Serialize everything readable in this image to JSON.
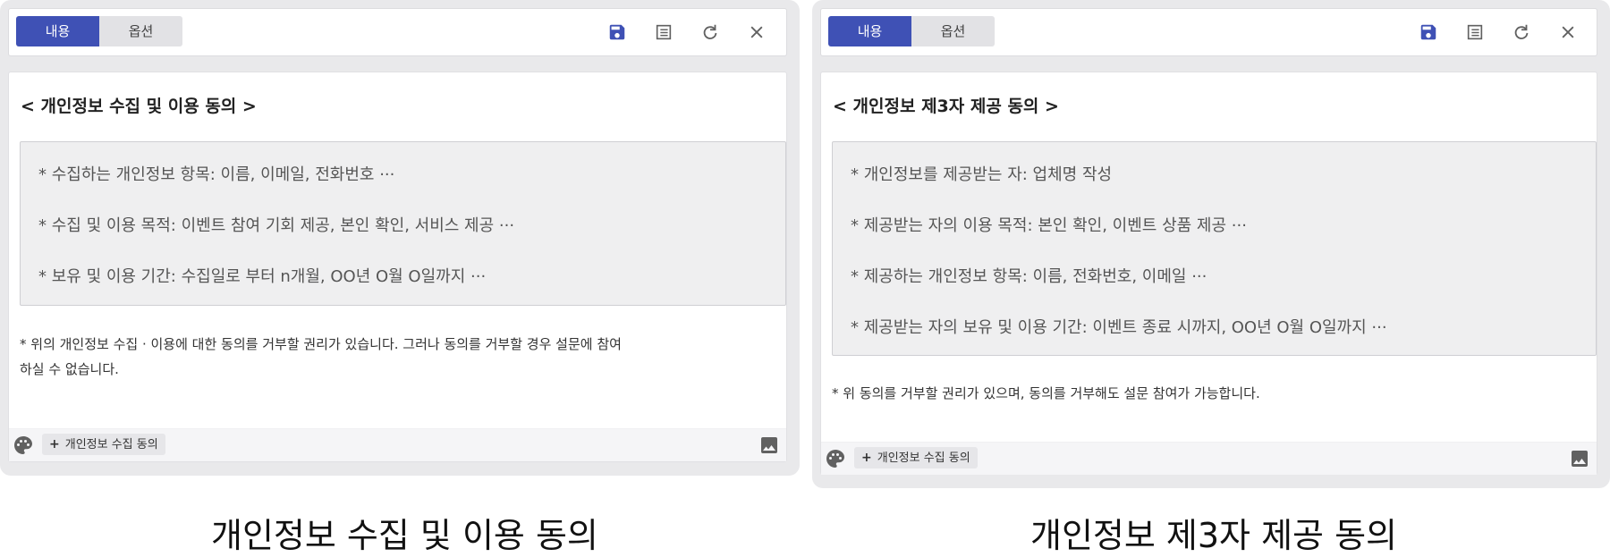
{
  "colors": {
    "accent": "#3f51b5",
    "panel_bg": "#e9e9eb",
    "box_bg": "#efeff0",
    "icon_gray": "#616161"
  },
  "panels": [
    {
      "tabs": {
        "content_label": "내용",
        "options_label": "옵션"
      },
      "toolbar": {
        "icons": [
          "save-icon",
          "list-icon",
          "undo-icon",
          "close-icon"
        ]
      },
      "title": "< 개인정보 수집 및 이용 동의 >",
      "items": [
        "* 수집하는 개인정보 항목: 이름, 이메일, 전화번호 ···",
        "* 수집 및 이용 목적: 이벤트 참여 기회 제공, 본인 확인, 서비스 제공 ···",
        "* 보유 및 이용 기간: 수집일로 부터 n개월, OO년 O월 O일까지 ···"
      ],
      "note_lines": [
        "* 위의 개인정보 수집 · 이용에 대한 동의를 거부할 권리가 있습니다. 그러나 동의를 거부할 경우 설문에 참여",
        "하실 수 없습니다."
      ],
      "footer": {
        "tag_label": "개인정보 수집 동의",
        "plus": "+"
      },
      "caption": "개인정보 수집 및 이용 동의"
    },
    {
      "tabs": {
        "content_label": "내용",
        "options_label": "옵션"
      },
      "toolbar": {
        "icons": [
          "save-icon",
          "list-icon",
          "undo-icon",
          "close-icon"
        ]
      },
      "title": "< 개인정보 제3자 제공 동의 >",
      "items": [
        "* 개인정보를 제공받는 자: 업체명 작성",
        "* 제공받는 자의 이용 목적: 본인 확인, 이벤트 상품 제공 ···",
        "* 제공하는 개인정보 항목: 이름, 전화번호, 이메일 ···",
        "* 제공받는 자의 보유 및 이용 기간: 이벤트 종료 시까지, OO년 O월 O일까지 ···"
      ],
      "note_lines": [
        "* 위 동의를 거부할 권리가 있으며, 동의를 거부해도 설문 참여가 가능합니다."
      ],
      "footer": {
        "tag_label": "개인정보 수집 동의",
        "plus": "+"
      },
      "caption": "개인정보 제3자 제공 동의"
    }
  ]
}
